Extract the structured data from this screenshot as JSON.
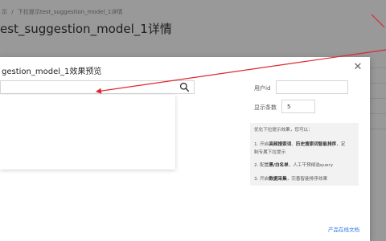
{
  "breadcrumb": {
    "parent": "示",
    "separator": "/",
    "current": "下拉提示test_suggestion_model_1详情"
  },
  "page": {
    "title": "est_suggestion_model_1详情"
  },
  "modal": {
    "title": "gestion_model_1效果预览",
    "close_icon": "close-icon",
    "search": {
      "value": "",
      "placeholder": "",
      "icon": "search-icon"
    },
    "user_id": {
      "label": "用户id",
      "value": ""
    },
    "display_count": {
      "label": "显示条数",
      "value": "5"
    },
    "tips": {
      "heading": "优化下拉提示效果，您可以：",
      "item1_prefix": "1. 开启",
      "item1_bold1": "高频搜索词",
      "item1_sep": "、",
      "item1_bold2": "历史搜索词智能排序",
      "item1_suffix": "，定",
      "item1_line2": "制专属下拉提示",
      "item2_prefix": "2. 配置",
      "item2_bold": "黑/白名单",
      "item2_suffix": "，人工干预候选query",
      "item3_prefix": "3. 开启",
      "item3_bold": "数据采集",
      "item3_suffix": "，完善智能排序效果"
    },
    "doc_link": "产品在线文档"
  },
  "colors": {
    "accent": "#2d7be5",
    "annotation": "#e0262b",
    "overlay": "rgba(0,0,0,0.40)"
  }
}
